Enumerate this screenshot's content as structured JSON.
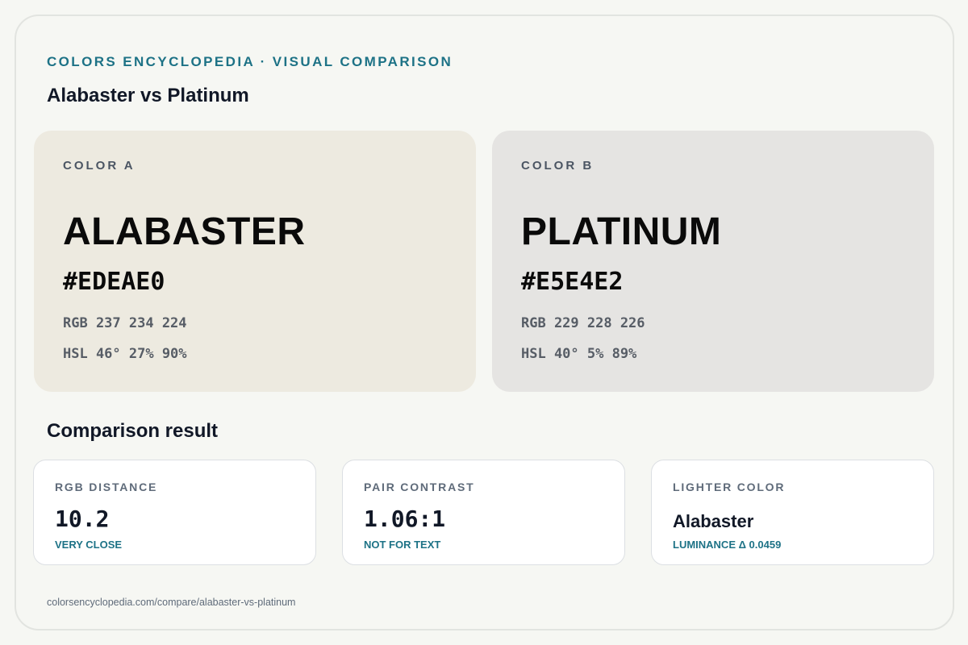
{
  "header": {
    "eyebrow": "COLORS ENCYCLOPEDIA · VISUAL COMPARISON",
    "title": "Alabaster vs Platinum"
  },
  "colors": [
    {
      "kicker": "COLOR A",
      "name": "ALABASTER",
      "hex": "#EDEAE0",
      "rgb": "RGB 237 234 224",
      "hsl": "HSL 46° 27% 90%",
      "swatch_color": "#EDEAE0"
    },
    {
      "kicker": "COLOR B",
      "name": "PLATINUM",
      "hex": "#E5E4E2",
      "rgb": "RGB 229 228 226",
      "hsl": "HSL 40° 5% 89%",
      "swatch_color": "#E5E4E2"
    }
  ],
  "comparison": {
    "title": "Comparison result",
    "stats": [
      {
        "label": "RGB DISTANCE",
        "value": "10.2",
        "note": "VERY CLOSE"
      },
      {
        "label": "PAIR CONTRAST",
        "value": "1.06:1",
        "note": "NOT FOR TEXT"
      },
      {
        "label": "LIGHTER COLOR",
        "value": "Alabaster",
        "note": "LUMINANCE Δ 0.0459"
      }
    ]
  },
  "footer": {
    "url": "colorsencyclopedia.com/compare/alabaster-vs-platinum"
  },
  "theme": {
    "accent": "#1D7286",
    "background": "#F6F7F3"
  }
}
